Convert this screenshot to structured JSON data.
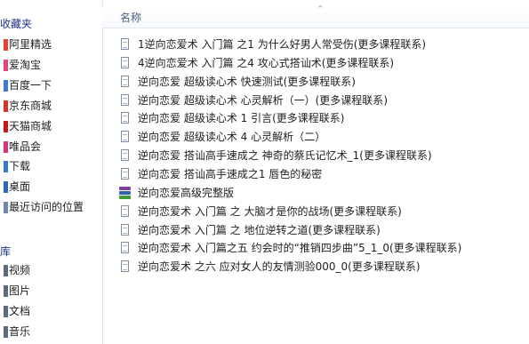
{
  "sidebar": {
    "favorites_heading": "收藏夹",
    "favorites": [
      {
        "label": "阿里精选",
        "icon": "link-icon",
        "color": "#e5422f"
      },
      {
        "label": "爱淘宝",
        "icon": "link-icon",
        "color": "#e94276"
      },
      {
        "label": "百度一下",
        "icon": "link-icon",
        "color": "#3f7ad8"
      },
      {
        "label": "京东商城",
        "icon": "link-icon",
        "color": "#d9342b"
      },
      {
        "label": "天猫商城",
        "icon": "link-icon",
        "color": "#c9161d"
      },
      {
        "label": "唯品会",
        "icon": "link-icon",
        "color": "#d8327a"
      },
      {
        "label": "下载",
        "icon": "download-folder-icon",
        "color": "#3a79c9"
      },
      {
        "label": "桌面",
        "icon": "desktop-icon",
        "color": "#2d69b8"
      },
      {
        "label": "最近访问的位置",
        "icon": "recent-places-icon",
        "color": "#6f86a6"
      }
    ],
    "library_heading": "库",
    "libraries": [
      {
        "label": "视频",
        "icon": "video-library-icon",
        "color": "#5b6b80"
      },
      {
        "label": "图片",
        "icon": "picture-library-icon",
        "color": "#5b6b80"
      },
      {
        "label": "文档",
        "icon": "document-library-icon",
        "color": "#5b6b80"
      },
      {
        "label": "音乐",
        "icon": "music-library-icon",
        "color": "#5b6b80"
      }
    ]
  },
  "file_list": {
    "column_name": "名称",
    "sort_indicator": "^",
    "files": [
      {
        "name": "1逆向恋爱术 入门篇 之1 为什么好男人常受伤(更多课程联系)",
        "icon": "document-icon"
      },
      {
        "name": "4逆向恋爱术 入门篇 之4 攻心式搭讪术(更多课程联系)",
        "icon": "document-icon"
      },
      {
        "name": "逆向恋爱 超级读心术  快速测试(更多课程联系)",
        "icon": "document-icon"
      },
      {
        "name": "逆向恋爱 超级读心术  心灵解析（一）(更多课程联系)",
        "icon": "document-icon"
      },
      {
        "name": "逆向恋爱 超级读心术 1 引言(更多课程联系)",
        "icon": "document-icon"
      },
      {
        "name": "逆向恋爱 超级读心术 4 心灵解析（二）",
        "icon": "document-icon"
      },
      {
        "name": "逆向恋爱 搭讪高手速成之 神奇的蔡氏记忆术_1(更多课程联系)",
        "icon": "document-icon"
      },
      {
        "name": "逆向恋爱 搭讪高手速成之1 唇色的秘密",
        "icon": "document-icon"
      },
      {
        "name": "逆向恋爱高级完整版",
        "icon": "rar-archive-icon"
      },
      {
        "name": "逆向恋爱术 入门篇 之  大脑才是你的战场(更多课程联系)",
        "icon": "document-icon"
      },
      {
        "name": "逆向恋爱术 入门篇 之 地位逆转之道(更多课程联系)",
        "icon": "document-icon"
      },
      {
        "name": "逆向恋爱术 入门篇之五 约会时的“推销四步曲”5_1_0(更多课程联系)",
        "icon": "document-icon"
      },
      {
        "name": "逆向恋爱术 之六 应对女人的友情测验000_0(更多课程联系)",
        "icon": "document-icon"
      }
    ]
  }
}
